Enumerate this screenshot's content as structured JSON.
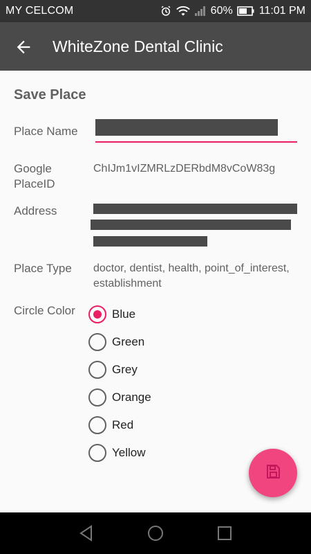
{
  "status_bar": {
    "carrier": "MY CELCOM",
    "battery": "60%",
    "time": "11:01 PM",
    "icons": [
      "alarm-icon",
      "wifi-icon",
      "signal-icon",
      "battery-icon"
    ]
  },
  "app_bar": {
    "title": "WhiteZone Dental Clinic",
    "back_icon": "arrow-back-icon"
  },
  "form": {
    "section_title": "Save Place",
    "place_name_label": "Place Name",
    "place_id_label": "Google PlaceID",
    "place_id_value": "ChIJm1vIZMRLzDERbdM8vCoW83g",
    "address_label": "Address",
    "place_type_label": "Place Type",
    "place_type_line1": "doctor, dentist, health, point_of_interest,",
    "place_type_line2": "establishment",
    "circle_color_label": "Circle Color",
    "colors": [
      "Blue",
      "Green",
      "Grey",
      "Orange",
      "Red",
      "Yellow"
    ],
    "selected_color": "Blue"
  },
  "fab": {
    "icon": "save-icon"
  },
  "theme": {
    "accent": "#e91e63",
    "fab": "#f0457f",
    "app_bar": "#4a4a4a",
    "status_bar": "#333333"
  }
}
